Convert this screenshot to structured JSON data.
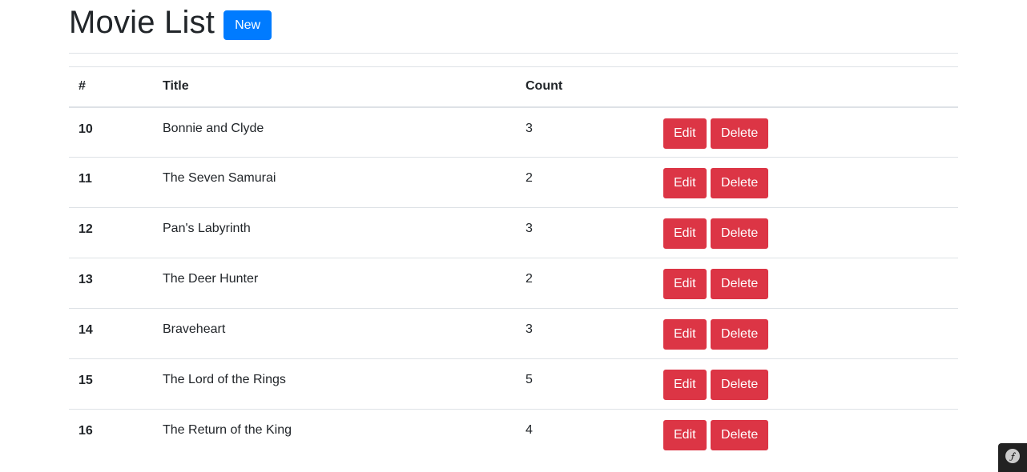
{
  "header": {
    "title": "Movie List",
    "new_button": "New"
  },
  "table": {
    "columns": [
      "#",
      "Title",
      "Count",
      ""
    ],
    "rows": [
      {
        "id": "10",
        "title": "Bonnie and Clyde",
        "count": "3"
      },
      {
        "id": "11",
        "title": "The Seven Samurai",
        "count": "2"
      },
      {
        "id": "12",
        "title": "Pan's Labyrinth",
        "count": "3"
      },
      {
        "id": "13",
        "title": "The Deer Hunter",
        "count": "2"
      },
      {
        "id": "14",
        "title": "Braveheart",
        "count": "3"
      },
      {
        "id": "15",
        "title": "The Lord of the Rings",
        "count": "5"
      },
      {
        "id": "16",
        "title": "The Return of the King",
        "count": "4"
      }
    ],
    "edit_label": "Edit",
    "delete_label": "Delete"
  },
  "toolbar": {
    "icon": "symfony-logo-icon"
  },
  "colors": {
    "primary": "#007bff",
    "danger": "#dc3545",
    "border": "#dee2e6",
    "text": "#212529",
    "toolbar_bg": "#222222"
  }
}
